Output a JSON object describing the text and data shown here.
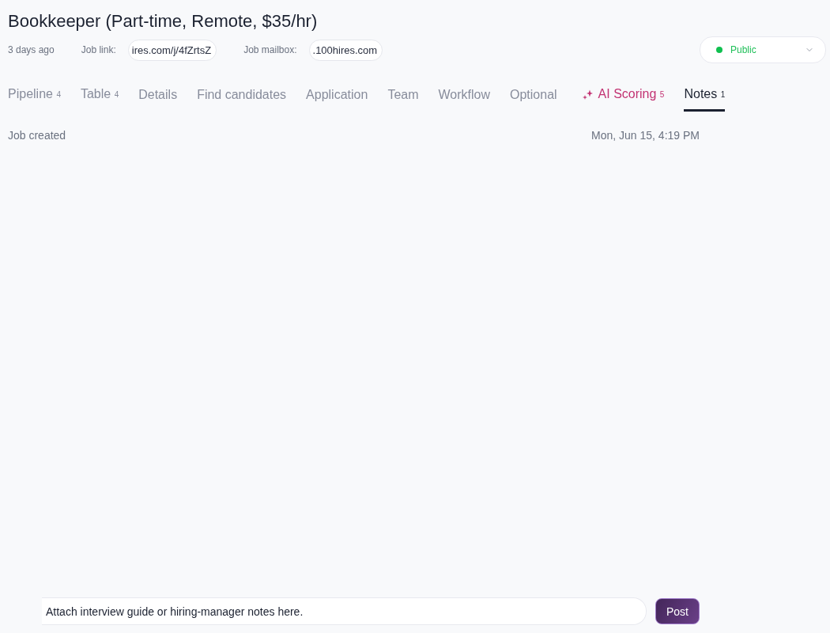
{
  "job": {
    "title": "Bookkeeper (Part-time, Remote, $35/hr)",
    "posted": "3 days ago",
    "link_label": "Job link:",
    "link_value": "ires.com/j/4fZrtsZ",
    "mailbox_label": "Job mailbox:",
    "mailbox_value": ".100hires.com"
  },
  "visibility": {
    "label": "Public"
  },
  "tabs": [
    {
      "label": "Pipeline",
      "count": "4",
      "kind": "plain",
      "selected": false
    },
    {
      "label": "Table",
      "count": "4",
      "kind": "plain",
      "selected": false
    },
    {
      "label": "Details",
      "kind": "plain",
      "selected": false
    },
    {
      "label": "Find candidates",
      "kind": "plain",
      "selected": false
    },
    {
      "label": "Application",
      "kind": "plain",
      "selected": false
    },
    {
      "label": "Team",
      "kind": "plain",
      "selected": false
    },
    {
      "label": "Workflow",
      "kind": "plain",
      "selected": false
    },
    {
      "label": "Optional",
      "kind": "plain",
      "selected": false
    },
    {
      "label": "AI Scoring",
      "count": "5",
      "kind": "ai",
      "selected": false
    },
    {
      "label": "Notes",
      "count": "1",
      "kind": "plain",
      "selected": true
    }
  ],
  "notes": [
    {
      "text": "Job created",
      "time": "Mon, Jun 15, 4:19 PM"
    }
  ],
  "composer": {
    "value": "Attach interview guide or hiring-manager notes here.",
    "button": "Post"
  }
}
